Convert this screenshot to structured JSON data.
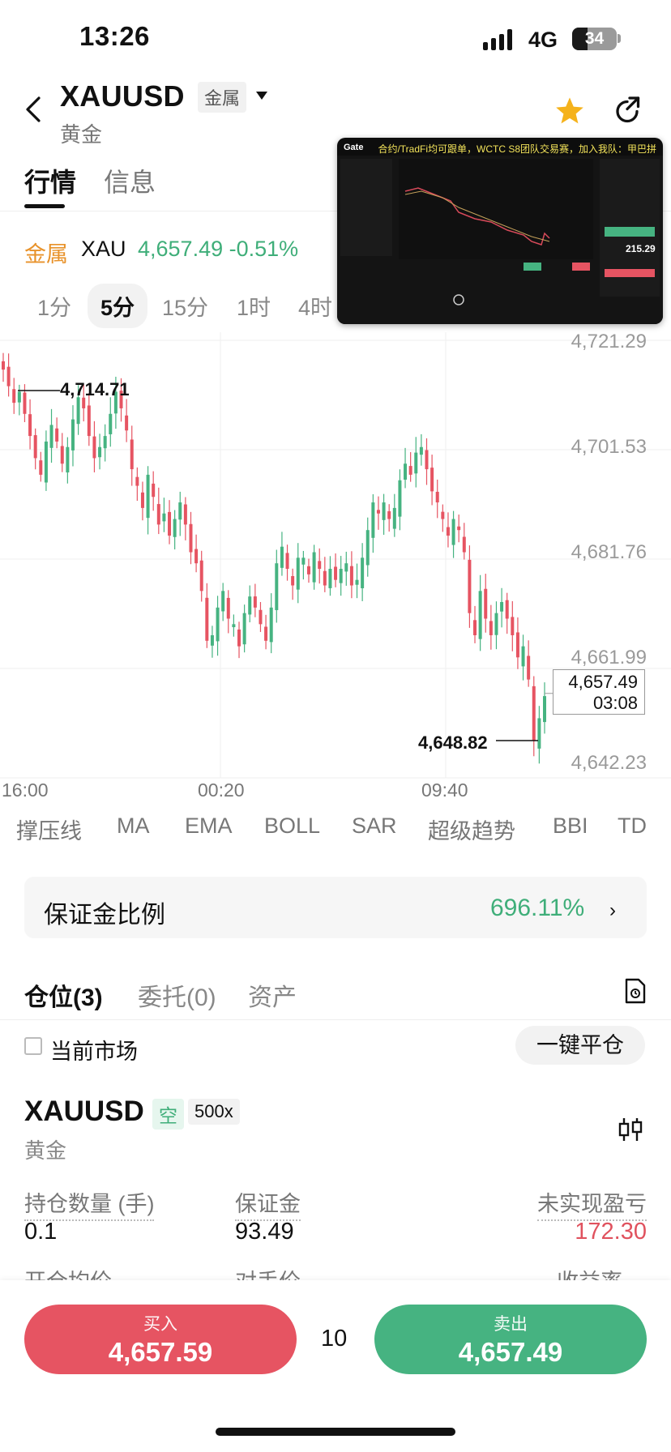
{
  "status_bar": {
    "time": "13:26",
    "network": "4G",
    "battery": "34"
  },
  "header": {
    "symbol": "XAUUSD",
    "category_badge": "金属",
    "subname": "黄金",
    "tabs": [
      {
        "label": "行情",
        "active": true
      },
      {
        "label": "信息",
        "active": false
      }
    ]
  },
  "ticker": {
    "category": "金属",
    "name": "XAU",
    "price_change": "4,657.49 -0.51%"
  },
  "intervals": [
    {
      "label": "1分",
      "active": false
    },
    {
      "label": "5分",
      "active": true
    },
    {
      "label": "15分",
      "active": false
    },
    {
      "label": "1时",
      "active": false
    },
    {
      "label": "4时",
      "active": false
    }
  ],
  "overlay": {
    "banner": "合约/TradFi均可跟单，WCTC S8团队交易赛，加入我队：甲巴拼",
    "brand": "Gate",
    "value": "215.29"
  },
  "chart_data": {
    "type": "candlestick",
    "y_ticks": [
      "4,721.29",
      "4,701.53",
      "4,681.76",
      "4,661.99",
      "4,642.23"
    ],
    "x_ticks": [
      "16:00",
      "00:20",
      "09:40"
    ],
    "high_marker": "4,714.71",
    "low_marker": "4,648.82",
    "last_price": "4,657.49",
    "countdown": "03:08",
    "ylim": [
      4642.23,
      4721.29
    ],
    "close_series": [
      4716,
      4713,
      4710,
      4712,
      4708,
      4704,
      4700,
      4697,
      4703,
      4706,
      4703,
      4699,
      4702,
      4707,
      4711,
      4709,
      4704,
      4700,
      4702,
      4704,
      4708,
      4712,
      4709,
      4705,
      4698,
      4695,
      4691,
      4697,
      4693,
      4688,
      4690,
      4686,
      4689,
      4692,
      4688,
      4683,
      4681,
      4676,
      4667,
      4668,
      4673,
      4676,
      4671,
      4670,
      4666,
      4672,
      4675,
      4673,
      4670,
      4667,
      4673,
      4681,
      4684,
      4680,
      4677,
      4682,
      4682,
      4679,
      4683,
      4680,
      4677,
      4680,
      4678,
      4680,
      4681,
      4677,
      4678,
      4682,
      4687,
      4692,
      4690,
      4692,
      4689,
      4691,
      4696,
      4699,
      4697,
      4701,
      4702,
      4698,
      4694,
      4692,
      4689,
      4686,
      4689,
      4687,
      4683,
      4672,
      4668,
      4676,
      4671,
      4668,
      4672,
      4674,
      4671,
      4668,
      4664,
      4666,
      4660,
      4649,
      4653,
      4657
    ]
  },
  "indicators": [
    "撑压线",
    "MA",
    "EMA",
    "BOLL",
    "SAR",
    "超级趋势",
    "BBI",
    "TD"
  ],
  "margin": {
    "label": "保证金比例",
    "value": "696.11%"
  },
  "position_tabs": [
    {
      "label": "仓位(3)",
      "active": true
    },
    {
      "label": "委托(0)",
      "active": false
    },
    {
      "label": "资产",
      "active": false
    }
  ],
  "filter": {
    "current_market": "当前市场",
    "close_all": "一键平仓"
  },
  "position": {
    "symbol": "XAUUSD",
    "side": "空",
    "leverage": "500x",
    "subname": "黄金",
    "stats": [
      {
        "label": "持仓数量 (手)",
        "value": "0.1",
        "tone": "default"
      },
      {
        "label": "保证金",
        "value": "93.49",
        "tone": "default"
      },
      {
        "label": "未实现盈亏",
        "value": "172.30",
        "tone": "red"
      }
    ],
    "next_labels": [
      "开仓均价",
      "对手价",
      "收益率"
    ]
  },
  "trade": {
    "buy_label": "买入",
    "buy_price": "4,657.59",
    "quantity": "10",
    "sell_label": "卖出",
    "sell_price": "4,657.49"
  },
  "colors": {
    "up": "#46b381",
    "down": "#e65462",
    "accent": "#e8922a"
  }
}
